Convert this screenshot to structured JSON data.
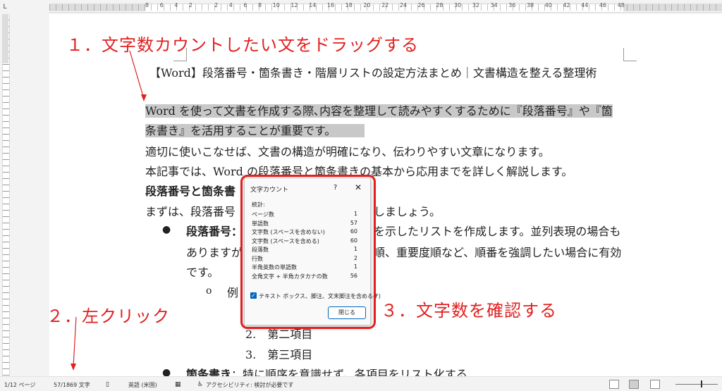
{
  "ruler": {
    "corner_glyph": "L",
    "numbers": [
      "8",
      "6",
      "4",
      "2",
      "",
      "2",
      "4",
      "6",
      "8",
      "10",
      "12",
      "14",
      "16",
      "18",
      "20",
      "22",
      "24",
      "26",
      "28",
      "30",
      "32",
      "34",
      "36",
      "38",
      "40",
      "42",
      "44",
      "46",
      "48"
    ]
  },
  "annotations": {
    "step1": "１．文字数カウントしたい文をドラッグする",
    "step2": "２．左クリック",
    "step3": "３．文字数を確認する",
    "color": "#e02020"
  },
  "document": {
    "title": "【Word】段落番号・箇条書き・階層リストの設定方法まとめ｜文書構造を整える整理術",
    "lines": {
      "l1": "Word を使って文書を作成する際､内容を整理して読みやすくするために『段落番号』や『箇",
      "l2": "条書き』を活用することが重要です。",
      "l3": "適切に使いこなせば、文書の構造が明確になり、伝わりやすい文章になります。",
      "l4": "本記事では、Word の段落番号と箇条書きの基本から応用までを詳しく解説します。",
      "l5": "段落番号と箇条書",
      "l6a": "まずは、段落番号",
      "l6b": "しましょう。",
      "l7a": "段落番号：",
      "l7b": "を示したリストを作成します。並列表現の場合も",
      "l8a": "ありますが",
      "l8b": "順、重要度順など、順番を強調したい場合に有効",
      "l9": "です。",
      "l10": "例",
      "l11": "2.　第二項目",
      "l12": "3.　第三項目",
      "l13a": "箇条書き",
      "l13b": "：特に順序を意識せず、各項目をリスト化する"
    },
    "bullet_glyph": "●",
    "sub_bullet_glyph": "o"
  },
  "dialog": {
    "title": "文字カウント",
    "help": "?",
    "close": "✕",
    "stats_label": "統計:",
    "rows": [
      {
        "label": "ページ数",
        "value": "1"
      },
      {
        "label": "単語数",
        "value": "57"
      },
      {
        "label": "文字数 (スペースを含めない)",
        "value": "60"
      },
      {
        "label": "文字数 (スペースを含める)",
        "value": "60"
      },
      {
        "label": "段落数",
        "value": "1"
      },
      {
        "label": "行数",
        "value": "2"
      },
      {
        "label": "半角英数の単語数",
        "value": "1"
      },
      {
        "label": "全角文字 + 半角カタカナの数",
        "value": "56"
      }
    ],
    "checkbox_label": "テキスト ボックス、脚注、文末脚注を含める(F)",
    "checkbox_checked": true,
    "close_button": "閉じる"
  },
  "status_bar": {
    "page": "1/12 ページ",
    "words": "57/1869 文字",
    "language": "英語 (米国)",
    "accessibility": "アクセシビリティ: 検討が必要です"
  }
}
